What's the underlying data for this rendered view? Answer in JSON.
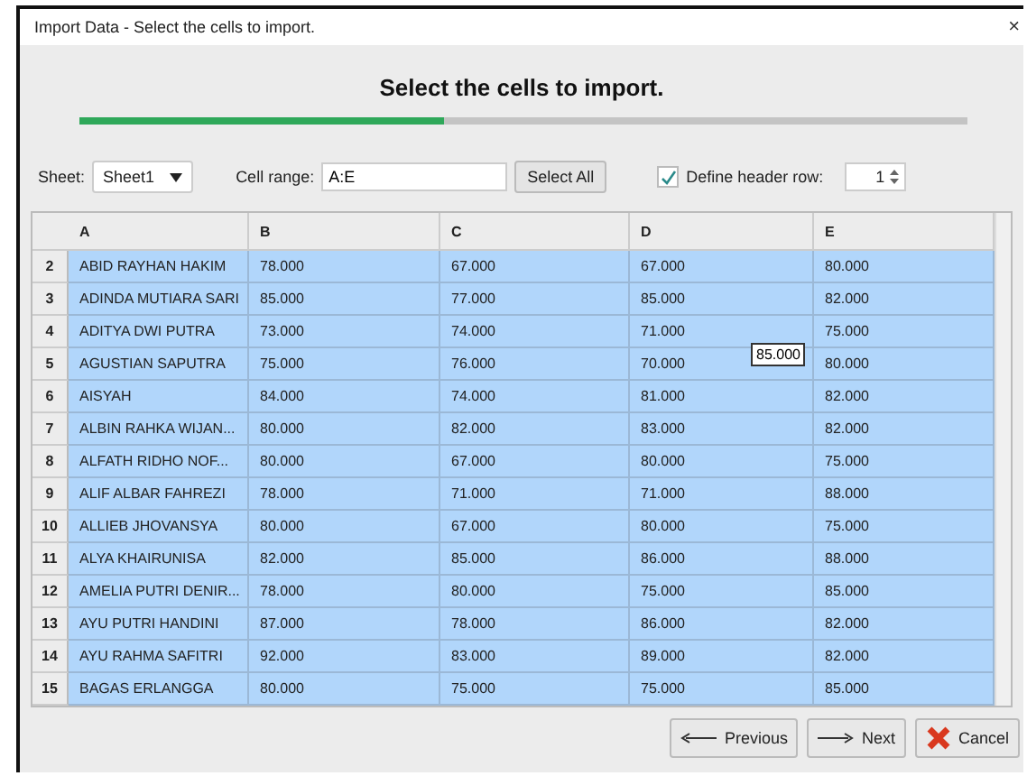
{
  "window": {
    "title": "Import Data - Select the cells to import.",
    "close": "×"
  },
  "heading": "Select the cells to import.",
  "progress": {
    "level": 0.41
  },
  "toolbar": {
    "sheet_label": "Sheet:",
    "sheet_value": "Sheet1",
    "range_label": "Cell range:",
    "range_value": "A:E",
    "select_all": "Select All",
    "header_checked": true,
    "header_label": "Define header row:",
    "header_row": "1"
  },
  "table": {
    "columns": [
      "A",
      "B",
      "C",
      "D",
      "E"
    ],
    "rows": [
      {
        "num": "2",
        "cells": [
          "ABID RAYHAN HAKIM",
          "78.000",
          "67.000",
          "67.000",
          "80.000"
        ]
      },
      {
        "num": "3",
        "cells": [
          "ADINDA MUTIARA SARI",
          "85.000",
          "77.000",
          "85.000",
          "82.000"
        ]
      },
      {
        "num": "4",
        "cells": [
          "ADITYA DWI PUTRA",
          "73.000",
          "74.000",
          "71.000",
          "75.000"
        ]
      },
      {
        "num": "5",
        "cells": [
          "AGUSTIAN SAPUTRA",
          "75.000",
          "76.000",
          "70.000",
          "80.000"
        ]
      },
      {
        "num": "6",
        "cells": [
          "AISYAH",
          "84.000",
          "74.000",
          "81.000",
          "82.000"
        ]
      },
      {
        "num": "7",
        "cells": [
          "ALBIN RAHKA WIJAN...",
          "80.000",
          "82.000",
          "83.000",
          "82.000"
        ]
      },
      {
        "num": "8",
        "cells": [
          "ALFATH RIDHO NOF...",
          "80.000",
          "67.000",
          "80.000",
          "75.000"
        ]
      },
      {
        "num": "9",
        "cells": [
          "ALIF ALBAR FAHREZI",
          "78.000",
          "71.000",
          "71.000",
          "88.000"
        ]
      },
      {
        "num": "10",
        "cells": [
          "ALLIEB JHOVANSYA",
          "80.000",
          "67.000",
          "80.000",
          "75.000"
        ]
      },
      {
        "num": "11",
        "cells": [
          "ALYA KHAIRUNISA",
          "82.000",
          "85.000",
          "86.000",
          "88.000"
        ]
      },
      {
        "num": "12",
        "cells": [
          "AMELIA PUTRI DENIR...",
          "78.000",
          "80.000",
          "75.000",
          "85.000"
        ]
      },
      {
        "num": "13",
        "cells": [
          "AYU PUTRI HANDINI",
          "87.000",
          "78.000",
          "86.000",
          "82.000"
        ]
      },
      {
        "num": "14",
        "cells": [
          "AYU RAHMA SAFITRI",
          "92.000",
          "83.000",
          "89.000",
          "82.000"
        ]
      },
      {
        "num": "15",
        "cells": [
          "BAGAS ERLANGGA",
          "80.000",
          "75.000",
          "75.000",
          "85.000"
        ]
      }
    ],
    "tooltip": "85.000"
  },
  "buttons": [
    {
      "kind": "previous",
      "label": "Previous"
    },
    {
      "kind": "next",
      "label": "Next"
    },
    {
      "kind": "cancel",
      "label": "Cancel"
    }
  ]
}
